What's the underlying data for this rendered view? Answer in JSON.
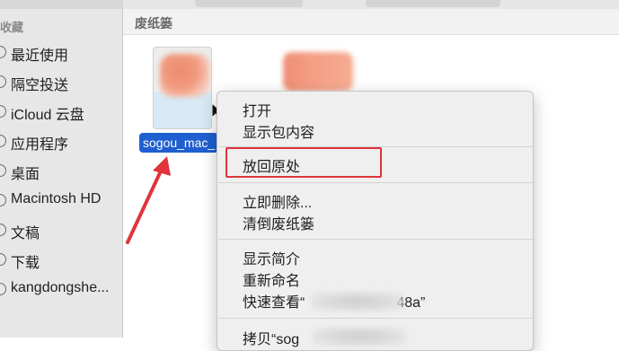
{
  "sidebar": {
    "section_title": "收藏",
    "items": [
      {
        "label": "最近使用",
        "icon": "clock-icon"
      },
      {
        "label": "隔空投送",
        "icon": "airdrop-icon"
      },
      {
        "label": "iCloud 云盘",
        "icon": "cloud-icon"
      },
      {
        "label": "应用程序",
        "icon": "applications-icon"
      },
      {
        "label": "桌面",
        "icon": "desktop-icon"
      },
      {
        "label": "Macintosh HD",
        "icon": "disk-icon"
      },
      {
        "label": "文稿",
        "icon": "document-icon"
      },
      {
        "label": "下载",
        "icon": "download-icon"
      },
      {
        "label": "kangdongshe...",
        "icon": "home-icon"
      }
    ]
  },
  "main": {
    "location_title": "废纸篓",
    "files": [
      {
        "label": "sogou_mac_"
      }
    ]
  },
  "context_menu": {
    "items": {
      "open": "打开",
      "show_package_contents": "显示包内容",
      "put_back": "放回原处",
      "delete_immediately": "立即删除...",
      "empty_trash": "清倒废纸篓",
      "get_info": "显示简介",
      "rename": "重新命名",
      "quick_look_prefix": "快速查看“",
      "quick_look_suffix": "48a”",
      "copy_prefix": "拷贝“sog"
    }
  },
  "colors": {
    "selection_blue": "#1f5fd0",
    "annotation_red": "#e0343b"
  }
}
